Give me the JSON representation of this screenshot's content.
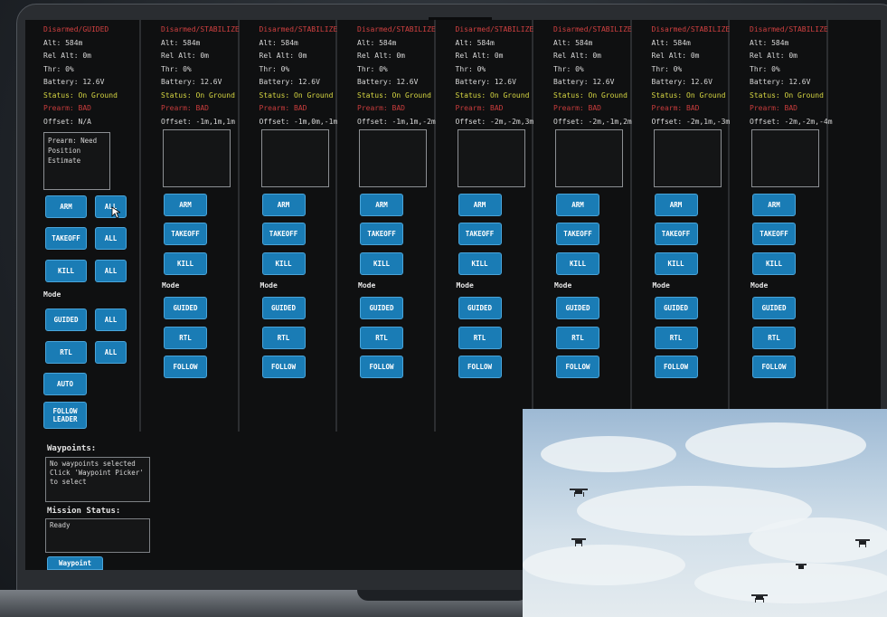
{
  "drones": [
    {
      "state": "Disarmed/GUIDED",
      "alt": "Alt: 584m",
      "rel_alt": "Rel Alt: 0m",
      "thr": "Thr: 0%",
      "battery": "Battery: 12.6V",
      "status": "Status: On Ground",
      "prearm": "Prearm: BAD",
      "offset": "Offset: N/A",
      "message": "Prearm: Need Position Estimate"
    },
    {
      "state": "Disarmed/STABILIZE",
      "alt": "Alt: 584m",
      "rel_alt": "Rel Alt: 0m",
      "thr": "Thr: 0%",
      "battery": "Battery: 12.6V",
      "status": "Status: On Ground",
      "prearm": "Prearm: BAD",
      "offset": "Offset: -1m,1m,1m",
      "message": ""
    },
    {
      "state": "Disarmed/STABILIZE",
      "alt": "Alt: 584m",
      "rel_alt": "Rel Alt: 0m",
      "thr": "Thr: 0%",
      "battery": "Battery: 12.6V",
      "status": "Status: On Ground",
      "prearm": "Prearm: BAD",
      "offset": "Offset: -1m,0m,-1m",
      "message": ""
    },
    {
      "state": "Disarmed/STABILIZE",
      "alt": "Alt: 584m",
      "rel_alt": "Rel Alt: 0m",
      "thr": "Thr: 0%",
      "battery": "Battery: 12.6V",
      "status": "Status: On Ground",
      "prearm": "Prearm: BAD",
      "offset": "Offset: -1m,1m,-2m",
      "message": ""
    },
    {
      "state": "Disarmed/STABILIZE",
      "alt": "Alt: 584m",
      "rel_alt": "Rel Alt: 0m",
      "thr": "Thr: 0%",
      "battery": "Battery: 12.6V",
      "status": "Status: On Ground",
      "prearm": "Prearm: BAD",
      "offset": "Offset: -2m,-2m,3m",
      "message": ""
    },
    {
      "state": "Disarmed/STABILIZE",
      "alt": "Alt: 584m",
      "rel_alt": "Rel Alt: 0m",
      "thr": "Thr: 0%",
      "battery": "Battery: 12.6V",
      "status": "Status: On Ground",
      "prearm": "Prearm: BAD",
      "offset": "Offset: -2m,-1m,2m",
      "message": ""
    },
    {
      "state": "Disarmed/STABILIZE",
      "alt": "Alt: 584m",
      "rel_alt": "Rel Alt: 0m",
      "thr": "Thr: 0%",
      "battery": "Battery: 12.6V",
      "status": "Status: On Ground",
      "prearm": "Prearm: BAD",
      "offset": "Offset: -2m,1m,-3m",
      "message": ""
    },
    {
      "state": "Disarmed/STABILIZE",
      "alt": "Alt: 584m",
      "rel_alt": "Rel Alt: 0m",
      "thr": "Thr: 0%",
      "battery": "Battery: 12.6V",
      "status": "Status: On Ground",
      "prearm": "Prearm: BAD",
      "offset": "Offset: -2m,-2m,-4m",
      "message": ""
    }
  ],
  "buttons": {
    "arm": "ARM",
    "all": "ALL",
    "takeoff": "TAKEOFF",
    "kill": "KILL",
    "guided": "GUIDED",
    "rtl": "RTL",
    "auto": "AUTO",
    "follow_leader": "FOLLOW LEADER",
    "follow": "FOLLOW",
    "waypoint": "Waypoint"
  },
  "mode_label": "Mode",
  "waypoints": {
    "title": "Waypoints:",
    "text": "No waypoints selected Click 'Waypoint Picker' to select"
  },
  "mission": {
    "title": "Mission Status:",
    "text": "Ready"
  },
  "colors": {
    "button": "#1a7cb5",
    "state": "#d04040",
    "status": "#d6d642",
    "background": "#0f1011"
  },
  "icons": [
    "mouse-cursor-icon",
    "drone-icon"
  ]
}
